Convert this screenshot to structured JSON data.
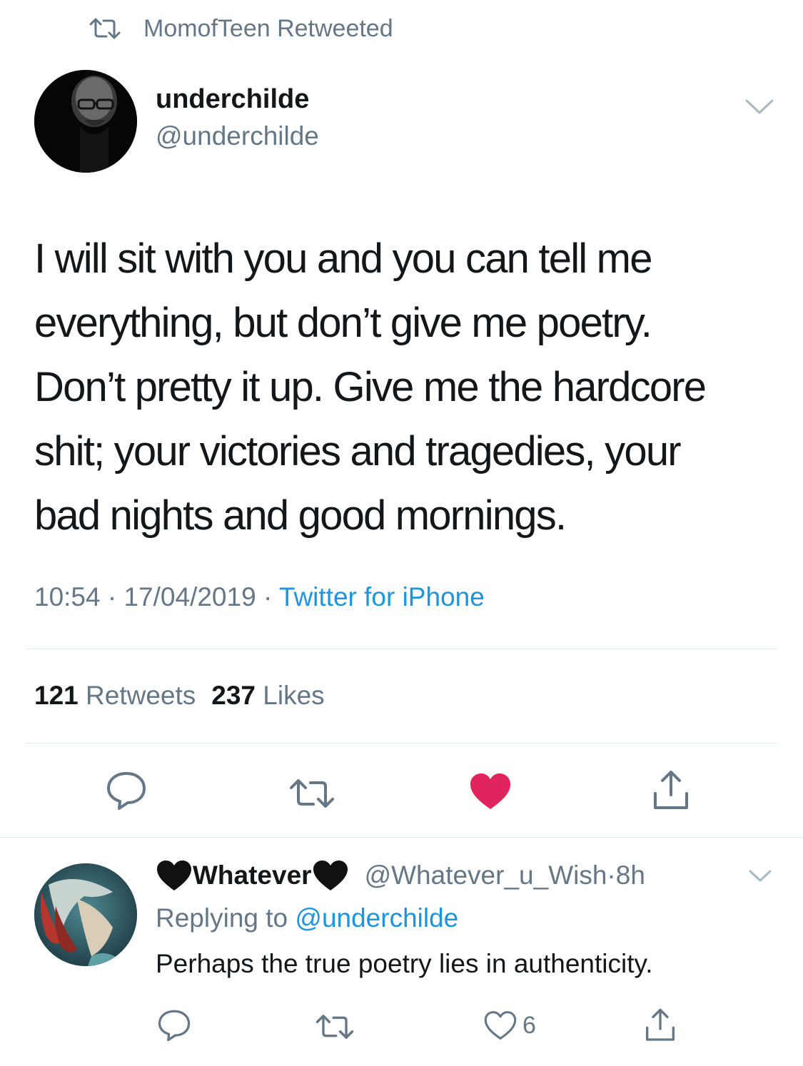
{
  "retweet_context": {
    "icon": "retweet-icon",
    "text": "MomofTeen Retweeted"
  },
  "tweet": {
    "author_name": "underchilde",
    "author_handle": "@underchilde",
    "avatar": "avatar-photo",
    "body": "I will sit with you and you can tell me\neverything, but don’t give me poetry.\nDon’t pretty it up. Give me the hardcore\nshit; your victories and tragedies, your\nbad nights and good mornings.",
    "time": "10:54",
    "sep1": " · ",
    "date": "17/04/2019",
    "sep2": " · ",
    "source": "Twitter for iPhone",
    "retweets_count": "121",
    "retweets_label": "Retweets",
    "likes_count": "237",
    "likes_label": "Likes",
    "liked": true,
    "colors": {
      "like_active": "#e0245e",
      "link": "#1b95e0",
      "secondary": "#657786",
      "divider": "#e1e8ed"
    }
  },
  "reply": {
    "display_name": "Whatever",
    "name_emoji": "black-heart-icon",
    "handle": "@Whatever_u_Wish",
    "sep": " · ",
    "time": "8h",
    "replying_prefix": "Replying to",
    "replying_to": "@underchilde",
    "text": "Perhaps the true poetry lies in authenticity.",
    "like_count": "6"
  }
}
